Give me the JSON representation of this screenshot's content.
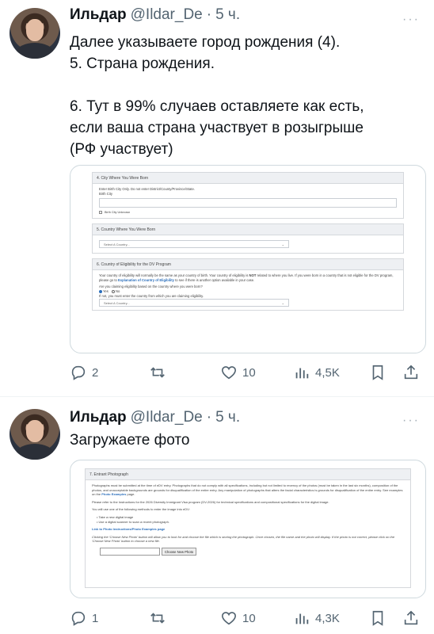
{
  "tweets": [
    {
      "author": "Ильдар",
      "handle": "@Ildar_De",
      "separator": "·",
      "time": "5 ч.",
      "more": "···",
      "lines": [
        "Далее указываете город рождения (4).",
        "5. Страна рождения.",
        "",
        "6. Тут в 99% случаев оставляете как есть,",
        "если ваша страна участвует в розыгрыше",
        "(РФ участвует)"
      ],
      "form": {
        "city_section": "4. City Where You Were Born",
        "city_instruction": "Enter Birth City Only. Do not enter District/County/Province/State.",
        "city_label": "Birth City",
        "city_unknown": "Birth City Unknown",
        "country_section": "5. Country Where You Were Born",
        "select_placeholder": "Select A Country...",
        "eligibility_section": "6. Country of Eligibility for the DV Program",
        "eligibility_text_1": "Your country of eligibility will normally be the same as your country of birth. Your country of eligibility is",
        "eligibility_not": "NOT",
        "eligibility_text_2": "related to where you live. If you were born in a country that is not eligible for the DV program, please go to",
        "eligibility_link": "Explanation of Country of Eligibility",
        "eligibility_text_3": "to see if there is another option available in your case.",
        "claim_question": "Are you claiming eligibility based on the country where you were born?",
        "yes": "Yes",
        "no": "No",
        "claim_note": "If not, you must enter the country from which you are claiming eligibility."
      },
      "stats": {
        "replies": "2",
        "retweets": "",
        "likes": "10",
        "views": "4,5K"
      }
    },
    {
      "author": "Ильдар",
      "handle": "@Ildar_De",
      "separator": "·",
      "time": "5 ч.",
      "more": "···",
      "lines": [
        "Загружаете фото"
      ],
      "form": {
        "section": "7. Entrant Photograph",
        "p1": "Photographs must be submitted at the time of eDV entry. Photographs that do not comply with all specifications, including but not limited to recency of the photos (must be taken in the last six months), composition of the photos, and unacceptable backgrounds are grounds for disqualification of the entire entry. Any manipulation of photographs that alters the facial characteristics is grounds for disqualification of the entire entry. See examples on the",
        "p1_link": "Photo Examples",
        "p1_end": "page.",
        "p2": "Please refer to the Instructions for the 2026 Diversity Immigrant Visa program (DV-2026) for technical specifications and compositional specifications for the digital image.",
        "p3": "You will use one of the following methods to enter the image into eDV:",
        "bullet1": "• Take a new digital image",
        "bullet2": "• Use a digital scanner to scan a recent photograph.",
        "link": "Link to Photo Instructions/Photo Examples page",
        "p4": "Clicking the 'Choose New Photo' button will allow you to look for and choose the file which is storing the photograph. Once chosen, the file name and the photo will display. If the photo is not correct, please click on the 'Choose New Photo' button to choose a new file.",
        "button": "Choose New Photo"
      },
      "stats": {
        "replies": "1",
        "retweets": "",
        "likes": "10",
        "views": "4,3K"
      }
    }
  ],
  "colors": {
    "text": "#0f1419",
    "muted": "#536471",
    "border": "#cfd9de",
    "link": "#2a6ebb"
  },
  "icons": [
    "reply-icon",
    "retweet-icon",
    "like-icon",
    "views-icon",
    "bookmark-icon",
    "share-icon"
  ]
}
